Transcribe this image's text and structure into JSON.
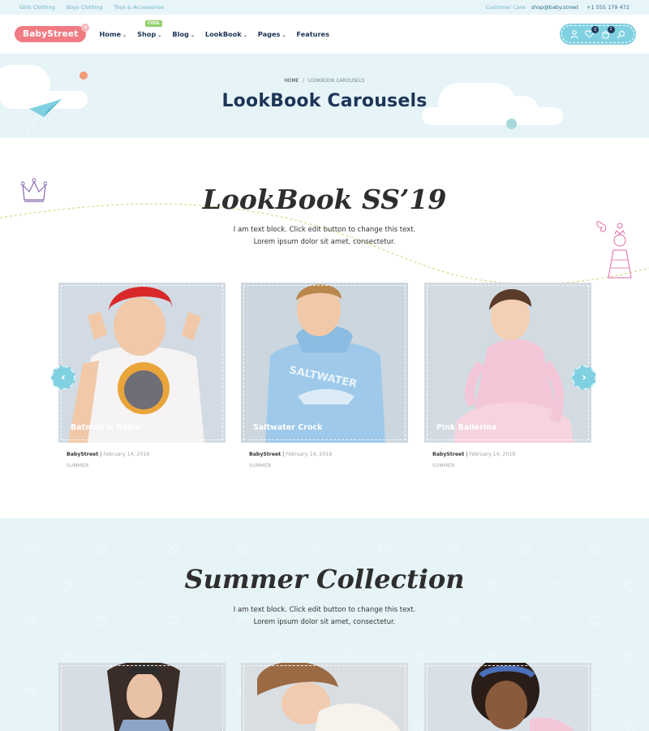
{
  "topbar": {
    "links": [
      "Girls Clothing",
      "Boys Clothing",
      "Toys & Accessories"
    ],
    "care_label": "Customer Care:",
    "email": "shop@baby.street",
    "phone": "+1 555 179 472"
  },
  "header": {
    "logo": "BabyStreet",
    "nav": [
      {
        "label": "Home",
        "caret": true,
        "badge": ""
      },
      {
        "label": "Shop",
        "caret": true,
        "badge": "COOL"
      },
      {
        "label": "Blog",
        "caret": true,
        "badge": ""
      },
      {
        "label": "LookBook",
        "caret": true,
        "badge": ""
      },
      {
        "label": "Pages",
        "caret": true,
        "badge": ""
      },
      {
        "label": "Features",
        "caret": false,
        "badge": ""
      }
    ],
    "wishlist_count": "0",
    "cart_count": "1"
  },
  "hero": {
    "breadcrumb_home": "HOME",
    "breadcrumb_sep": "/",
    "breadcrumb_current": "LOOKBOOK CAROUSELS",
    "title": "LookBook Carousels"
  },
  "lookbook": {
    "title": "LookBook SS’19",
    "desc_line1": "I am text block. Click edit button to change this text.",
    "desc_line2": "Lorem ipsum dolor sit amet, consectetur.",
    "cards": [
      {
        "caption": "Batman & Robin",
        "author": "BabyStreet",
        "date": "February 14, 2019",
        "tag": "SUMMER",
        "bg": "#d2dbe3"
      },
      {
        "caption": "Saltwater Crock",
        "author": "BabyStreet",
        "date": "February 14, 2019",
        "tag": "SUMMER",
        "bg": "#ccd6df"
      },
      {
        "caption": "Pink Ballerina",
        "author": "BabyStreet",
        "date": "February 14, 2019",
        "tag": "SUMMER",
        "bg": "#d3dbe2"
      }
    ]
  },
  "summer": {
    "title": "Summer Collection",
    "desc_line1": "I am text block. Click edit button to change this text.",
    "desc_line2": "Lorem ipsum dolor sit amet, consectetur."
  },
  "colors": {
    "accent": "#7fd0e1",
    "logo": "#f07b83",
    "navy": "#1d3557",
    "hero_bg": "#e6f4f7"
  }
}
